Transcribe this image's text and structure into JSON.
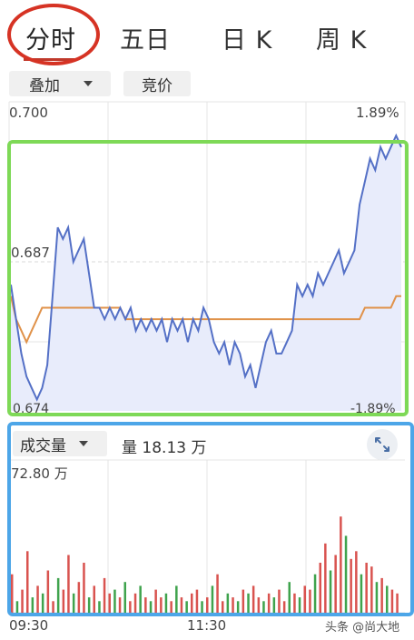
{
  "tabs": [
    {
      "label": "分时",
      "active": true
    },
    {
      "label": "五日",
      "active": false
    },
    {
      "label": "日 K",
      "active": false
    },
    {
      "label": "周 K",
      "active": false
    }
  ],
  "toolbar": {
    "overlay_label": "叠加",
    "auction_label": "竞价"
  },
  "price_chart": {
    "y_top_price": "0.700",
    "y_top_pct": "1.89%",
    "y_mid_price": "0.687",
    "y_bottom_price": "0.674",
    "y_bottom_pct": "-1.89%"
  },
  "volume_panel": {
    "selector_label": "成交量",
    "volume_text": "量 18.13 万",
    "max_label": "72.80 万"
  },
  "time_axis": {
    "start": "09:30",
    "mid": "11:30"
  },
  "watermark": "头条 @尚大地",
  "colors": {
    "price_line": "#5470c6",
    "avg_line": "#e0924a",
    "up_bar": "#d9534f",
    "down_bar": "#3fa34d",
    "annotation_red": "#d63324",
    "annotation_green": "#7ed957",
    "annotation_blue": "#4da6e8"
  },
  "chart_data": [
    {
      "type": "line",
      "title": "",
      "ylim": [
        0.674,
        0.7
      ],
      "series": [
        {
          "values": [
            0.685,
            0.682,
            0.679,
            0.677,
            0.676,
            0.675,
            0.676,
            0.678,
            0.684,
            0.69,
            0.689,
            0.69,
            0.687,
            0.688,
            0.689,
            0.686,
            0.683,
            0.683,
            0.682,
            0.683,
            0.682,
            0.683,
            0.682,
            0.683,
            0.681,
            0.682,
            0.681,
            0.682,
            0.681,
            0.682,
            0.68,
            0.682,
            0.681,
            0.682,
            0.68,
            0.682,
            0.681,
            0.683,
            0.682,
            0.68,
            0.679,
            0.68,
            0.678,
            0.68,
            0.679,
            0.677,
            0.678,
            0.676,
            0.678,
            0.68,
            0.681,
            0.679,
            0.679,
            0.68,
            0.681,
            0.685,
            0.684,
            0.685,
            0.684,
            0.686,
            0.685,
            0.686,
            0.687,
            0.688,
            0.686,
            0.687,
            0.688,
            0.692,
            0.694,
            0.696,
            0.695,
            0.697,
            0.696,
            0.697,
            0.698,
            0.697
          ]
        },
        {
          "values": [
            0.684,
            0.682,
            0.681,
            0.68,
            0.681,
            0.682,
            0.683,
            0.683,
            0.683,
            0.683,
            0.683,
            0.683,
            0.683,
            0.683,
            0.683,
            0.683,
            0.683,
            0.683,
            0.683,
            0.683,
            0.683,
            0.683,
            0.682,
            0.682,
            0.682,
            0.682,
            0.682,
            0.682,
            0.682,
            0.682,
            0.682,
            0.682,
            0.682,
            0.682,
            0.682,
            0.682,
            0.682,
            0.682,
            0.682,
            0.682,
            0.682,
            0.682,
            0.682,
            0.682,
            0.682,
            0.682,
            0.682,
            0.682,
            0.682,
            0.682,
            0.682,
            0.682,
            0.682,
            0.682,
            0.682,
            0.682,
            0.682,
            0.682,
            0.682,
            0.682,
            0.682,
            0.682,
            0.682,
            0.682,
            0.682,
            0.682,
            0.682,
            0.682,
            0.683,
            0.683,
            0.683,
            0.683,
            0.683,
            0.683,
            0.684,
            0.684
          ]
        }
      ]
    },
    {
      "type": "bar",
      "title": "",
      "ylim": [
        0,
        72.8
      ],
      "values": [
        20,
        6,
        12,
        32,
        8,
        14,
        10,
        22,
        6,
        18,
        12,
        30,
        10,
        16,
        26,
        8,
        14,
        6,
        18,
        10,
        12,
        8,
        16,
        6,
        10,
        14,
        8,
        6,
        12,
        8,
        10,
        6,
        14,
        8,
        6,
        10,
        12,
        6,
        8,
        14,
        20,
        6,
        10,
        8,
        6,
        12,
        10,
        14,
        8,
        6,
        10,
        8,
        12,
        6,
        16,
        10,
        8,
        14,
        12,
        20,
        26,
        36,
        22,
        30,
        50,
        40,
        28,
        32,
        20,
        26,
        24,
        16,
        18,
        14,
        12,
        10
      ],
      "colors": [
        "up",
        "down",
        "up",
        "up",
        "down",
        "up",
        "down",
        "up",
        "up",
        "down",
        "up",
        "up",
        "down",
        "up",
        "up",
        "down",
        "up",
        "down",
        "up",
        "up",
        "down",
        "up",
        "down",
        "up",
        "up",
        "down",
        "up",
        "down",
        "up",
        "up",
        "down",
        "up",
        "down",
        "up",
        "down",
        "up",
        "up",
        "down",
        "up",
        "down",
        "up",
        "up",
        "down",
        "up",
        "down",
        "up",
        "down",
        "up",
        "up",
        "down",
        "up",
        "down",
        "up",
        "up",
        "down",
        "up",
        "down",
        "up",
        "up",
        "down",
        "up",
        "up",
        "down",
        "up",
        "up",
        "down",
        "up",
        "up",
        "down",
        "up",
        "up",
        "down",
        "up",
        "down",
        "up",
        "up"
      ]
    }
  ]
}
